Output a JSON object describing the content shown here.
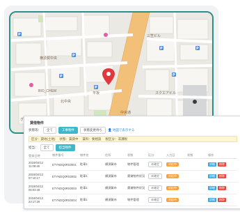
{
  "map": {
    "labels": [
      "横須賀中央",
      "平坂",
      "BIO_CHEM",
      "北中央",
      "三笠ビル",
      "スクエアビル",
      "中央通",
      "グリーン"
    ]
  },
  "card": {
    "title": "貸借物件",
    "filter1": {
      "label": "状態等：",
      "pills": [
        "全て",
        "工事物件",
        "状態変更待ち"
      ],
      "link": "地図で表示する"
    },
    "notice": {
      "items": [
        "区分：貸地(土地)",
        "状態：賃貸中",
        "賃料：要相談",
        "税区分：非課税"
      ]
    },
    "filter2": {
      "label": "担当：",
      "pills": [
        "全て",
        "担当物件"
      ]
    },
    "columns": [
      "登録日時",
      "物件番号",
      "物件名",
      "住所",
      "状態",
      "区分",
      "入力日",
      "状態",
      "操作"
    ],
    "rows": [
      {
        "date": "2018/04/12 11:08:46",
        "id": "ETYNDQ0RS0001",
        "name": "駐車1",
        "addr": "横須賀市",
        "type": "物件管理",
        "tag1": "未確定",
        "tag2": "対応中",
        "btn1": "詳細",
        "btn2": "削除"
      },
      {
        "date": "2018/04/12 07:10:17",
        "id": "ETYNDQ0RS0002",
        "name": "駐車1",
        "addr": "横須賀市",
        "type": "賃貸物件状況",
        "tag1": "未確定",
        "tag2": "対応中",
        "btn1": "詳細",
        "btn2": "削除"
      },
      {
        "date": "2018/04/12 06:03:48",
        "id": "ETYNDQ0RS0003",
        "name": "駐車1",
        "addr": "横須賀市",
        "type": "賃貸物件状況",
        "tag1": "未確定",
        "tag2": "対応中",
        "btn1": "詳細",
        "btn2": "削除"
      },
      {
        "date": "2018/04/12 23:17:28",
        "id": "ETYNDQ0RS0004",
        "name": "駐車1",
        "addr": "横須賀市",
        "type": "物件管理",
        "tag1": "未確定",
        "tag2": "対応中",
        "btn1": "詳細",
        "btn2": "削除"
      }
    ]
  },
  "colors": {
    "accent": "#2a8f86",
    "pill_active": "#3eb8c9",
    "tag_orange": "#f7a23b",
    "btn_blue": "#3fa7e0",
    "btn_red": "#e8443a",
    "marker": "#e0393d"
  }
}
